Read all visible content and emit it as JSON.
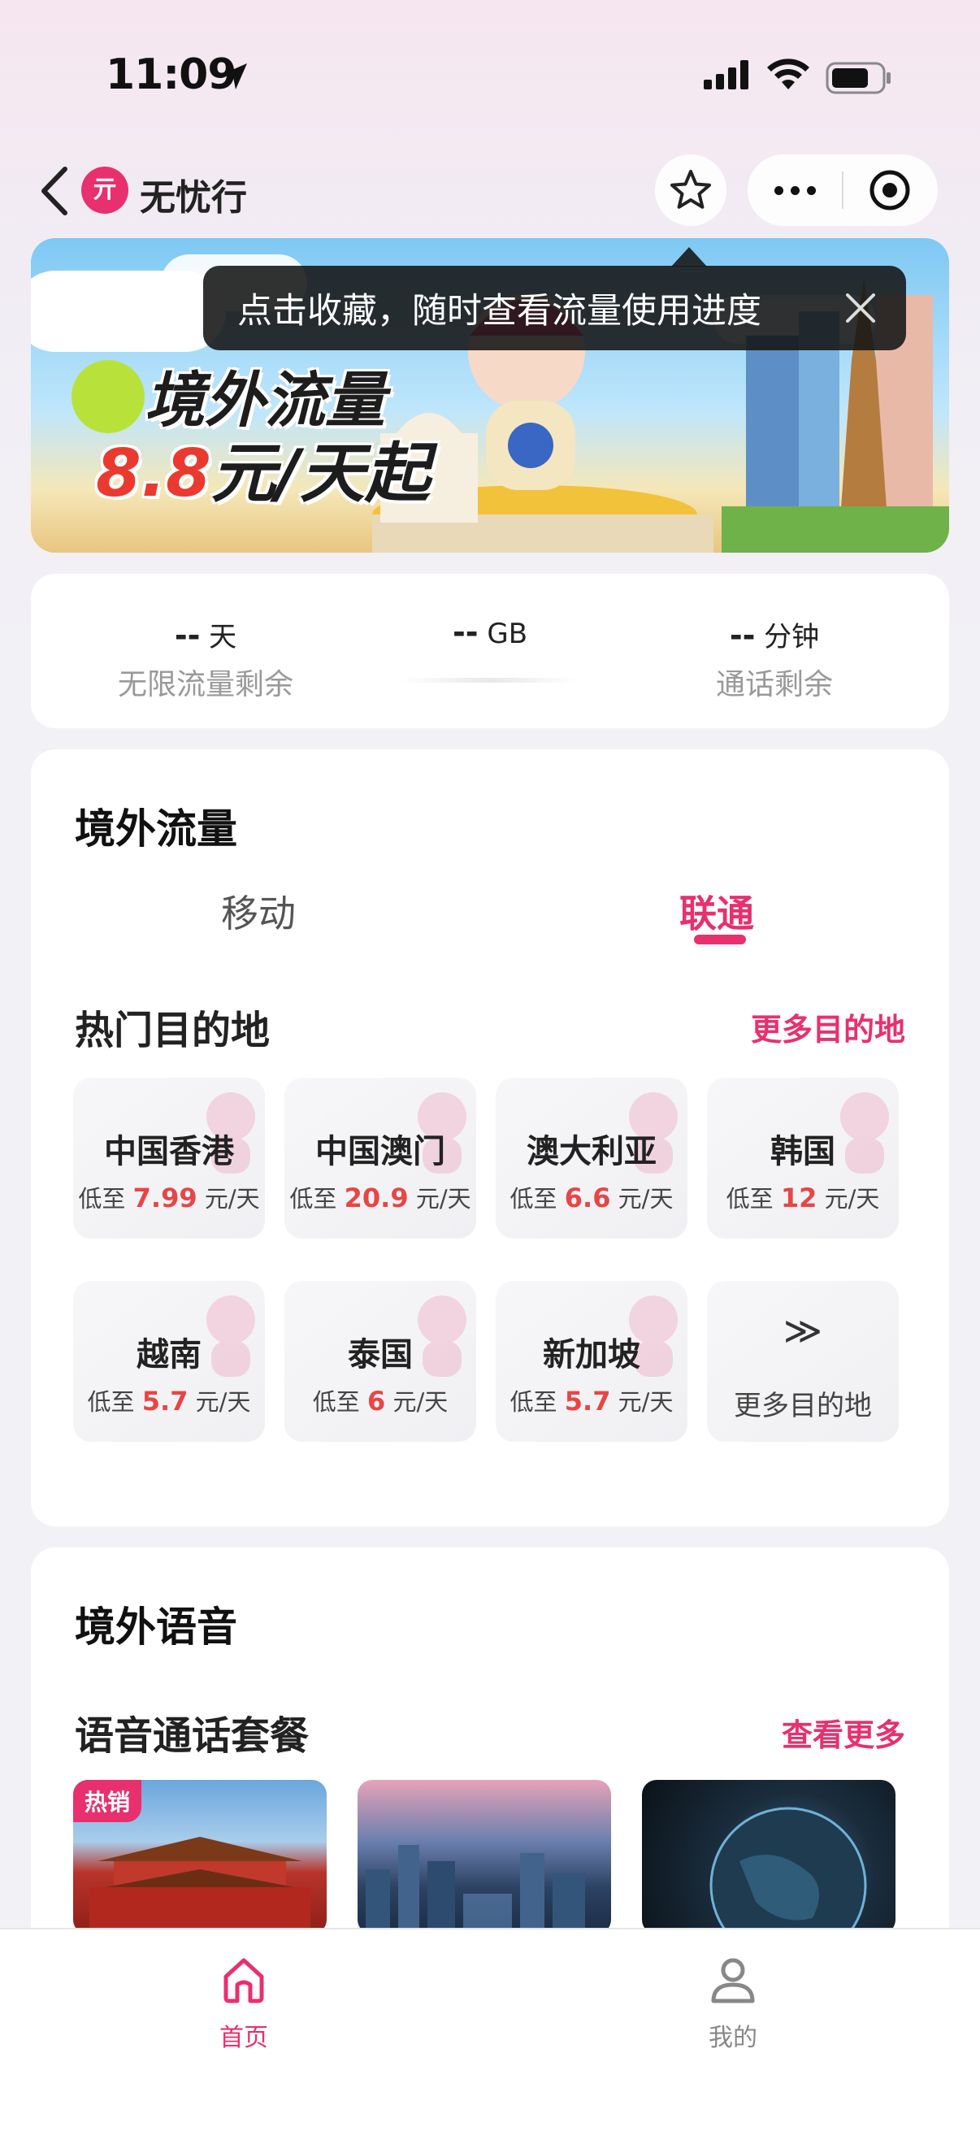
{
  "status_bar": {
    "time": "11:09"
  },
  "nav": {
    "brand_logo": "亓",
    "brand": "无忧行"
  },
  "banner": {
    "title_line1": "境外流量",
    "price": "8.8",
    "title_line2_suffix": "元/天起"
  },
  "tooltip": {
    "text": "点击收藏，随时查看流量使用进度"
  },
  "stats": [
    {
      "value": "--",
      "unit": "天",
      "label": "无限流量剩余"
    },
    {
      "value": "--",
      "unit": "GB",
      "label": ""
    },
    {
      "value": "--",
      "unit": "分钟",
      "label": "通话剩余"
    }
  ],
  "data_section": {
    "title": "境外流量",
    "tabs": [
      "移动",
      "联通"
    ],
    "active_tab": "联通",
    "hot_title": "热门目的地",
    "more_link": "更多目的地",
    "destinations": [
      {
        "name": "中国香港",
        "prefix": "低至",
        "price": "7.99",
        "suffix": "元/天"
      },
      {
        "name": "中国澳门",
        "prefix": "低至",
        "price": "20.9",
        "suffix": "元/天"
      },
      {
        "name": "澳大利亚",
        "prefix": "低至",
        "price": "6.6",
        "suffix": "元/天"
      },
      {
        "name": "韩国",
        "prefix": "低至",
        "price": "12",
        "suffix": "元/天"
      },
      {
        "name": "越南",
        "prefix": "低至",
        "price": "5.7",
        "suffix": "元/天"
      },
      {
        "name": "泰国",
        "prefix": "低至",
        "price": "6",
        "suffix": "元/天"
      },
      {
        "name": "新加坡",
        "prefix": "低至",
        "price": "5.7",
        "suffix": "元/天"
      }
    ],
    "more_tile": {
      "arrow": "≫",
      "label": "更多目的地"
    }
  },
  "voice_section": {
    "title": "境外语音",
    "subtitle": "语音通话套餐",
    "more_link": "查看更多",
    "hot_tag": "热销"
  },
  "tabbar": {
    "items": [
      {
        "label": "首页",
        "icon": "home-icon",
        "active": true
      },
      {
        "label": "我的",
        "icon": "profile-icon",
        "active": false
      }
    ]
  },
  "colors": {
    "accent": "#e8306f",
    "price_red": "#e84545"
  }
}
